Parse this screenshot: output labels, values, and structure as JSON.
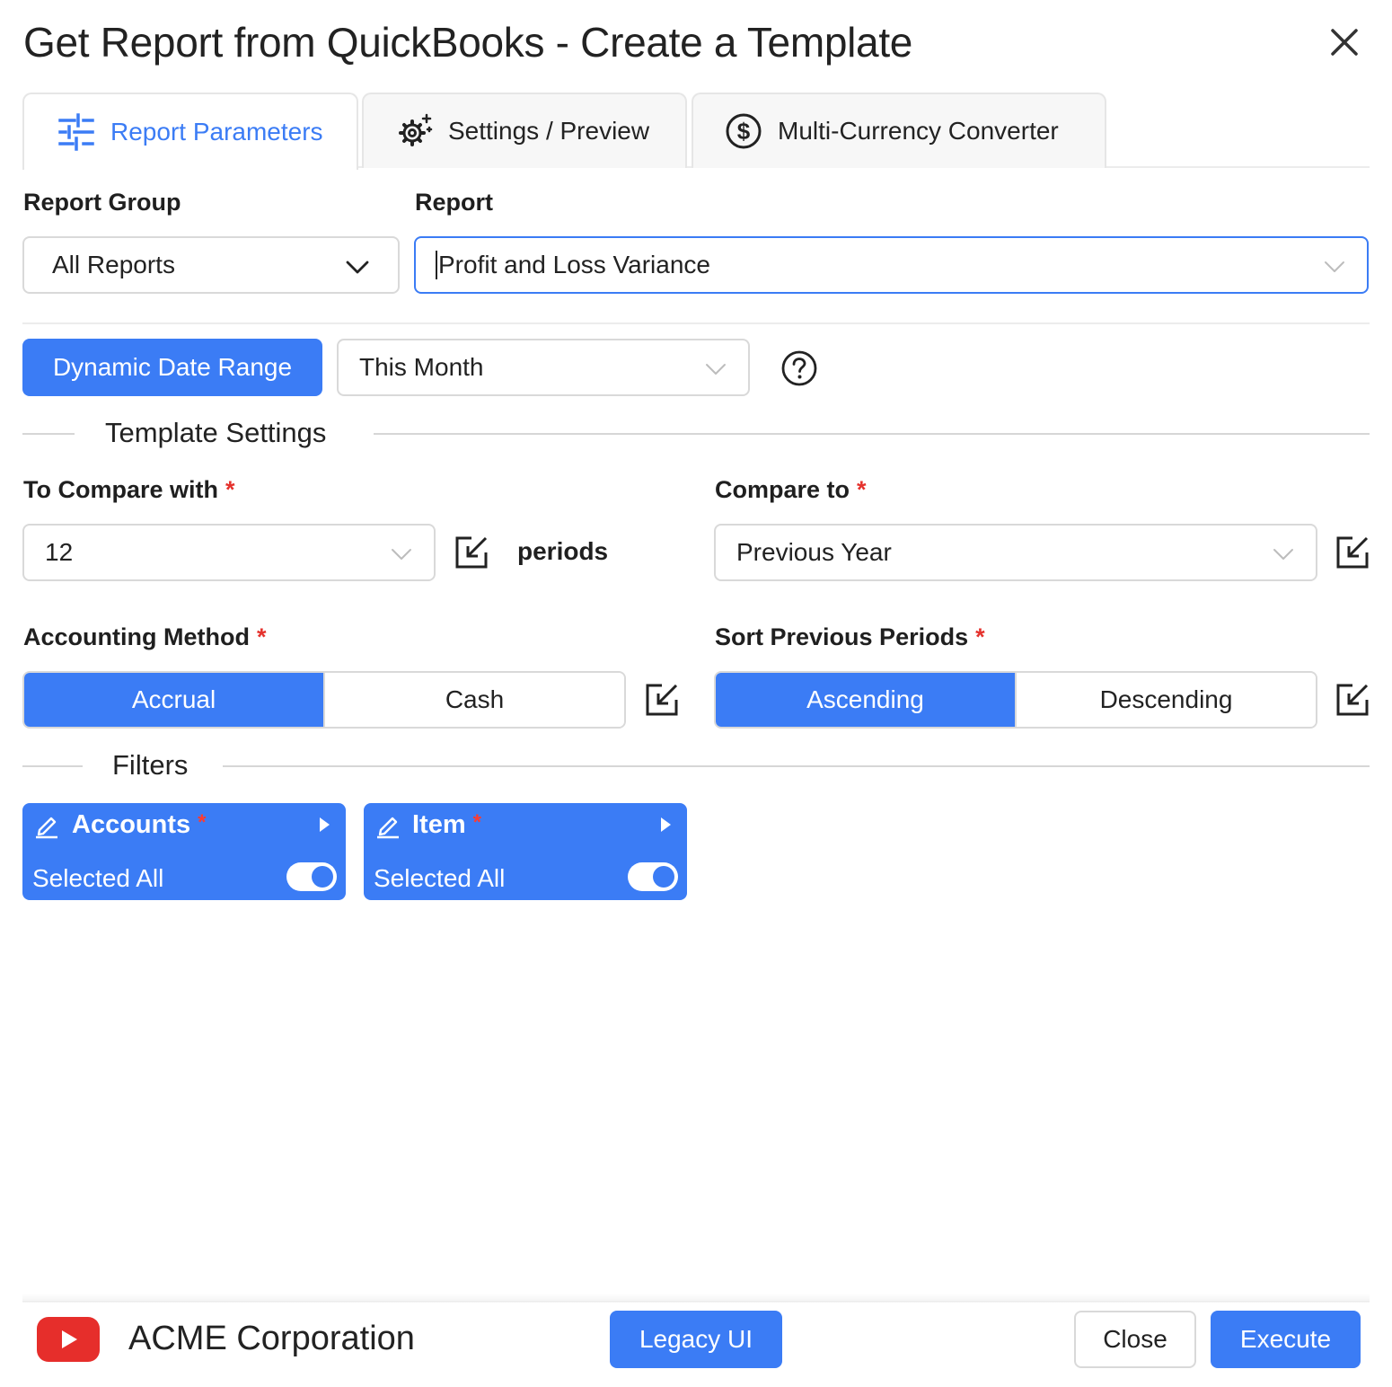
{
  "window": {
    "title": "Get Report from QuickBooks - Create a Template"
  },
  "tabs": [
    {
      "label": "Report Parameters",
      "icon": "sliders-icon",
      "active": true
    },
    {
      "label": "Settings / Preview",
      "icon": "gears-icon",
      "active": false
    },
    {
      "label": "Multi-Currency Converter",
      "icon": "dollar-circle-icon",
      "active": false
    }
  ],
  "report_group": {
    "label": "Report Group",
    "value": "All Reports"
  },
  "report": {
    "label": "Report",
    "value": "Profit and Loss Variance"
  },
  "date": {
    "button_label": "Dynamic Date Range",
    "value": "This Month"
  },
  "template_settings": {
    "title": "Template Settings",
    "compare_with": {
      "label": "To Compare with",
      "required": "*",
      "value": "12",
      "suffix": "periods"
    },
    "compare_to": {
      "label": "Compare to",
      "required": "*",
      "value": "Previous Year"
    },
    "accounting_method": {
      "label": "Accounting Method",
      "required": "*",
      "options": [
        "Accrual",
        "Cash"
      ],
      "selected": "Accrual"
    },
    "sort_previous": {
      "label": "Sort Previous Periods",
      "required": "*",
      "options": [
        "Ascending",
        "Descending"
      ],
      "selected": "Ascending"
    }
  },
  "filters": {
    "title": "Filters",
    "items": [
      {
        "title": "Accounts",
        "required": "*",
        "status": "Selected All",
        "enabled": true
      },
      {
        "title": "Item",
        "required": "*",
        "status": "Selected All",
        "enabled": true
      }
    ]
  },
  "footer": {
    "company": "ACME Corporation",
    "legacy_label": "Legacy UI",
    "close_label": "Close",
    "execute_label": "Execute"
  },
  "colors": {
    "accent": "#3b7cf5",
    "required": "#e5322d",
    "youtube": "#e62e2b"
  }
}
